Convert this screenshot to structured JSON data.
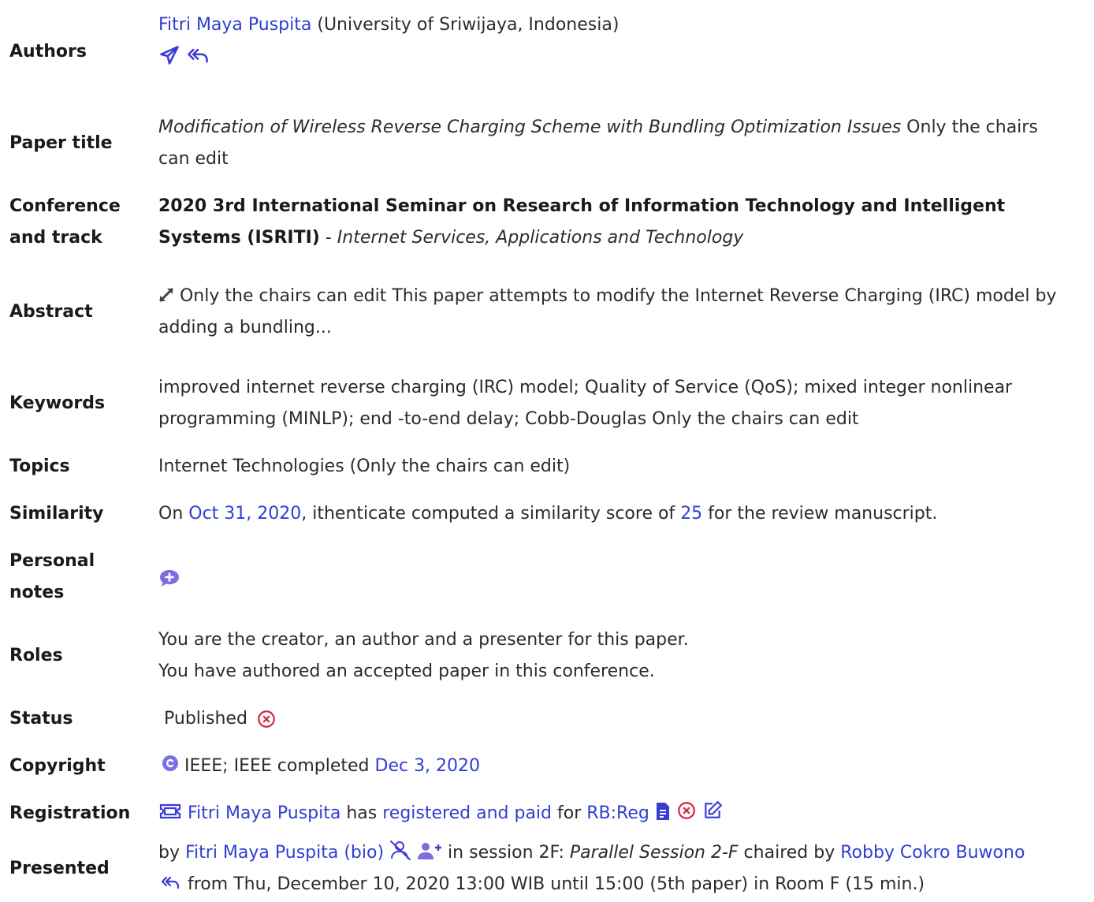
{
  "authors": {
    "label": "Authors",
    "name": "Fitri Maya Puspita",
    "affiliation": " (University of Sriwijaya, Indonesia)"
  },
  "paper_title": {
    "label": "Paper title",
    "title": "Modification of Wireless Reverse Charging Scheme with Bundling Optimization Issues",
    "note_line1": " Only the chairs",
    "note_line2": "can edit"
  },
  "conference": {
    "label_line1": "Conference",
    "label_line2": "and track",
    "name_line1": "2020 3rd International Seminar on Research of Information Technology and Intelligent",
    "name_line2": "Systems (ISRITI)",
    "separator": " - ",
    "track": "Internet Services, Applications and Technology"
  },
  "abstract": {
    "label": "Abstract",
    "line1": " Only the chairs can edit This paper attempts to modify the Internet Reverse Charging (IRC) model by",
    "line2": "adding a bundling..."
  },
  "keywords": {
    "label": "Keywords",
    "line1": "improved internet reverse charging (IRC) model; Quality of Service (QoS); mixed integer nonlinear",
    "line2": "programming (MINLP); end -to-end delay; Cobb-Douglas Only the chairs can edit"
  },
  "topics": {
    "label": "Topics",
    "value": "Internet Technologies (Only the chairs can edit)"
  },
  "similarity": {
    "label": "Similarity",
    "prefix": "On ",
    "date": "Oct 31, 2020",
    "middle": ", ithenticate computed a similarity score of ",
    "score": "25",
    "suffix": " for the review manuscript."
  },
  "personal_notes": {
    "label_line1": "Personal",
    "label_line2": "notes"
  },
  "roles": {
    "label": "Roles",
    "line1": "You are the creator, an author and a presenter for this paper.",
    "line2": "You have authored an accepted paper in this conference."
  },
  "status": {
    "label": "Status",
    "value": "Published"
  },
  "copyright": {
    "label": "Copyright",
    "text": " IEEE; IEEE completed ",
    "date": "Dec 3, 2020"
  },
  "registration": {
    "label": "Registration",
    "name": "Fitri Maya Puspita",
    "has": " has ",
    "status_link": "registered and paid",
    "for": " for ",
    "type": "RB:Reg"
  },
  "presented": {
    "label": "Presented",
    "by": "by ",
    "presenter": "Fitri Maya Puspita (bio)",
    "in_session": " in session 2F: ",
    "session_name": "Parallel Session 2-F",
    "chaired_by": " chaired by ",
    "chair": "Robby Cokro Buwono",
    "line2": " from Thu, December 10, 2020 13:00 WIB until 15:00 (5th paper) in Room F (15 min.)"
  },
  "colors": {
    "link": "#2f3ed3",
    "danger": "#d4213d",
    "note_bubble": "#7b6fe0"
  },
  "icons": [
    "send-icon",
    "reply-all-icon",
    "expand-icon",
    "add-note-icon",
    "cancel-icon",
    "copyright-icon",
    "ticket-icon",
    "document-icon",
    "edit-icon",
    "user-remove-icon",
    "user-add-icon"
  ]
}
